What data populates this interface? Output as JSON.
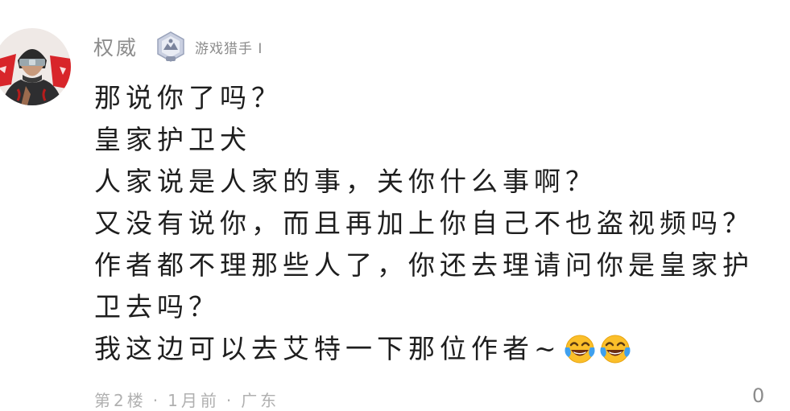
{
  "comment": {
    "username": "权威",
    "badge": {
      "icon": "gamer-badge-icon",
      "label": "游戏猎手 I"
    },
    "lines": [
      "那说你了吗？",
      "皇家护卫犬",
      "人家说是人家的事，关你什么事啊？",
      "又没有说你，而且再加上你自己不也盗视频吗？",
      "作者都不理那些人了，你还去理请问你是皇家护",
      "卫去吗？",
      "我这边可以去艾特一下那位作者~"
    ],
    "emojis": [
      "laugh-cry-emoji",
      "laugh-cry-emoji"
    ],
    "footer": {
      "floor": "第2楼",
      "date": "1月前",
      "source": "广东"
    },
    "reply_count": "0"
  },
  "colors": {
    "name_gray": "#8c8c8c",
    "text": "#1e1e1e",
    "emoji_yellow": "#fbbf2a",
    "tear_blue": "#3fa0ee"
  }
}
